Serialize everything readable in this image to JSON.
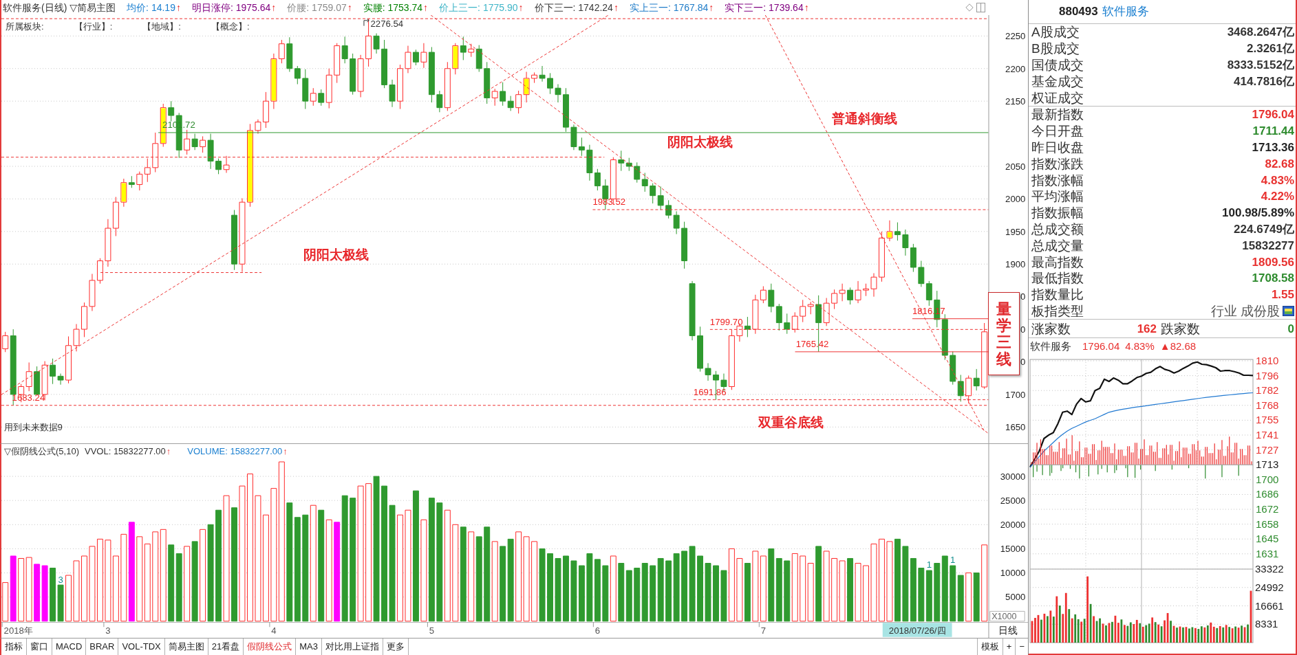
{
  "header": {
    "title": "软件服务(日线)",
    "template": "▽简易主图",
    "indicators": [
      {
        "text": "均价: 14.19",
        "trend": "↑",
        "color": "#1a7fd0"
      },
      {
        "text": "明日涨停: 1975.64",
        "trend": "↑",
        "color": "#800080"
      },
      {
        "text": "价腰: 1759.07",
        "trend": "↑",
        "color": "#8a8a8a"
      },
      {
        "text": "实腰: 1753.74",
        "trend": "↑",
        "color": "#008000"
      },
      {
        "text": "价上三一: 1775.90",
        "trend": "↑",
        "color": "#3fb5c8"
      },
      {
        "text": "价下三一: 1742.24",
        "trend": "↑",
        "color": "#3a3a3a"
      },
      {
        "text": "实上三一: 1767.84",
        "trend": "↑",
        "color": "#1f7cc8"
      },
      {
        "text": "实下三一: 1739.64",
        "trend": "↑",
        "color": "#800080"
      }
    ]
  },
  "sector": {
    "label": "所属板块:",
    "tags": [
      "【行业】:",
      "【地域】:",
      "【概念】:"
    ]
  },
  "price_chart": {
    "chart_data": {
      "type": "candlestick",
      "grid": true,
      "ylim": [
        1625,
        2282
      ],
      "yticks": [
        {
          "value": 2250,
          "label": "2250"
        },
        {
          "value": 2200,
          "label": "2200"
        },
        {
          "value": 2150,
          "label": "2150"
        },
        {
          "value": 2050,
          "label": "2050"
        },
        {
          "value": 2000,
          "label": "2000"
        },
        {
          "value": 1950,
          "label": "1950"
        },
        {
          "value": 1900,
          "label": "1900"
        },
        {
          "value": 1700,
          "label": "1700"
        },
        {
          "value": 1650,
          "label": "1650"
        }
      ],
      "ohlc": [
        [
          1770,
          1796,
          1765,
          1790
        ],
        [
          1790,
          1800,
          1683.24,
          1700
        ],
        [
          1700,
          1716,
          1688,
          1712
        ],
        [
          1712,
          1749,
          1705,
          1735
        ],
        [
          1735,
          1743,
          1700,
          1700
        ],
        [
          1700,
          1751,
          1691,
          1745
        ],
        [
          1745,
          1755,
          1716,
          1728
        ],
        [
          1728,
          1732,
          1715,
          1722
        ],
        [
          1722,
          1789,
          1717,
          1775
        ],
        [
          1775,
          1808,
          1766,
          1800
        ],
        [
          1800,
          1841,
          1788,
          1835
        ],
        [
          1835,
          1885,
          1828,
          1875
        ],
        [
          1875,
          1909,
          1870,
          1905
        ],
        [
          1905,
          1969,
          1896,
          1955
        ],
        [
          1955,
          2003,
          1943,
          1995
        ],
        [
          1995,
          2031,
          1988,
          2025
        ],
        [
          2025,
          2035,
          2017,
          2022
        ],
        [
          2022,
          2042,
          2013,
          2038
        ],
        [
          2038,
          2062,
          2026,
          2048
        ],
        [
          2048,
          2101.72,
          2041,
          2085
        ],
        [
          2085,
          2146,
          2080,
          2140
        ],
        [
          2140,
          2150,
          2119,
          2128
        ],
        [
          2128,
          2132,
          2063,
          2075
        ],
        [
          2075,
          2106,
          2068,
          2092
        ],
        [
          2092,
          2100,
          2075,
          2080
        ],
        [
          2080,
          2096,
          2071,
          2090
        ],
        [
          2090,
          2100,
          2046,
          2058
        ],
        [
          2058,
          2062,
          2038,
          2045
        ],
        [
          2045,
          2066,
          2040,
          2052
        ],
        [
          1975,
          1983,
          1891,
          1900
        ],
        [
          1900,
          2001,
          1888,
          1995
        ],
        [
          1995,
          2115,
          1988,
          2105
        ],
        [
          2105,
          2122,
          2100,
          2118
        ],
        [
          2118,
          2164,
          2109,
          2150
        ],
        [
          2150,
          2223,
          2138,
          2215
        ],
        [
          2215,
          2244,
          2208,
          2238
        ],
        [
          2238,
          2248,
          2195,
          2200
        ],
        [
          2200,
          2204,
          2176,
          2185
        ],
        [
          2185,
          2199,
          2138,
          2150
        ],
        [
          2150,
          2170,
          2143,
          2162
        ],
        [
          2162,
          2168,
          2143,
          2148
        ],
        [
          2148,
          2200,
          2139,
          2190
        ],
        [
          2190,
          2239,
          2178,
          2235
        ],
        [
          2235,
          2249,
          2208,
          2215
        ],
        [
          2215,
          2223,
          2160,
          2165
        ],
        [
          2165,
          2221,
          2156,
          2215
        ],
        [
          2215,
          2276.54,
          2203,
          2250
        ],
        [
          2250,
          2254,
          2223,
          2230
        ],
        [
          2230,
          2244,
          2170,
          2175
        ],
        [
          2175,
          2183,
          2141,
          2150
        ],
        [
          2150,
          2206,
          2138,
          2200
        ],
        [
          2200,
          2235,
          2193,
          2225
        ],
        [
          2225,
          2229,
          2205,
          2210
        ],
        [
          2210,
          2239,
          2201,
          2225
        ],
        [
          2225,
          2233,
          2148,
          2160
        ],
        [
          2160,
          2166,
          2133,
          2140
        ],
        [
          2140,
          2210,
          2135,
          2200
        ],
        [
          2200,
          2239,
          2191,
          2235
        ],
        [
          2235,
          2249,
          2213,
          2225
        ],
        [
          2225,
          2238,
          2218,
          2230
        ],
        [
          2230,
          2236,
          2195,
          2200
        ],
        [
          2200,
          2210,
          2146,
          2155
        ],
        [
          2155,
          2169,
          2143,
          2165
        ],
        [
          2165,
          2179,
          2143,
          2150
        ],
        [
          2150,
          2158,
          2135,
          2140
        ],
        [
          2140,
          2166,
          2131,
          2160
        ],
        [
          2160,
          2195,
          2148,
          2185
        ],
        [
          2185,
          2194,
          2178,
          2190
        ],
        [
          2190,
          2204,
          2180,
          2185
        ],
        [
          2185,
          2193,
          2161,
          2170
        ],
        [
          2170,
          2176,
          2148,
          2160
        ],
        [
          2160,
          2170,
          2103,
          2110
        ],
        [
          2110,
          2114,
          2075,
          2080
        ],
        [
          2080,
          2094,
          2066,
          2075
        ],
        [
          2075,
          2083,
          2028,
          2040
        ],
        [
          2040,
          2046,
          2013,
          2020
        ],
        [
          2020,
          2030,
          1983.52,
          2000
        ],
        [
          2000,
          2064,
          1991,
          2060
        ],
        [
          2060,
          2074,
          2043,
          2055
        ],
        [
          2055,
          2063,
          2043,
          2050
        ],
        [
          2050,
          2056,
          2025,
          2030
        ],
        [
          2030,
          2040,
          2011,
          2020
        ],
        [
          2020,
          2024,
          1993,
          2005
        ],
        [
          2005,
          2019,
          1983,
          1990
        ],
        [
          1990,
          1998,
          1970,
          1975
        ],
        [
          1975,
          1981,
          1946,
          1955
        ],
        [
          1955,
          1965,
          1893,
          1905
        ],
        [
          1870,
          1874,
          1783,
          1790
        ],
        [
          1790,
          1804,
          1735,
          1740
        ],
        [
          1740,
          1748,
          1721,
          1730
        ],
        [
          1730,
          1736,
          1691.86,
          1722
        ],
        [
          1722,
          1732,
          1705,
          1712
        ],
        [
          1712,
          1799.7,
          1707,
          1790
        ],
        [
          1790,
          1809,
          1781,
          1805
        ],
        [
          1805,
          1819,
          1788,
          1800
        ],
        [
          1800,
          1853,
          1793,
          1845
        ],
        [
          1845,
          1866,
          1840,
          1860
        ],
        [
          1860,
          1870,
          1826,
          1835
        ],
        [
          1835,
          1839,
          1798,
          1810
        ],
        [
          1810,
          1824,
          1793,
          1800
        ],
        [
          1800,
          1826,
          1795,
          1820
        ],
        [
          1820,
          1845,
          1811,
          1835
        ],
        [
          1835,
          1842,
          1823,
          1838
        ],
        [
          1838,
          1852,
          1765.42,
          1810
        ],
        [
          1810,
          1848,
          1805,
          1840
        ],
        [
          1840,
          1861,
          1831,
          1855
        ],
        [
          1855,
          1870,
          1843,
          1860
        ],
        [
          1860,
          1864,
          1838,
          1845
        ],
        [
          1845,
          1874,
          1840,
          1860
        ],
        [
          1860,
          1870,
          1851,
          1862
        ],
        [
          1862,
          1886,
          1850,
          1880
        ],
        [
          1880,
          1950,
          1873,
          1940
        ],
        [
          1940,
          1967,
          1935,
          1950
        ],
        [
          1950,
          1964,
          1936,
          1945
        ],
        [
          1945,
          1953,
          1913,
          1925
        ],
        [
          1925,
          1931,
          1888,
          1895
        ],
        [
          1895,
          1905,
          1865,
          1870
        ],
        [
          1870,
          1874,
          1836,
          1845
        ],
        [
          1845,
          1859,
          1803,
          1815
        ],
        [
          1815,
          1823,
          1753,
          1760
        ],
        [
          1760,
          1766,
          1715,
          1720
        ],
        [
          1720,
          1730,
          1689,
          1698
        ],
        [
          1698,
          1729,
          1686,
          1725
        ],
        [
          1725,
          1739,
          1706,
          1713
        ],
        [
          1711.44,
          1809.56,
          1708.58,
          1796.04
        ]
      ]
    },
    "axis_fragments": [
      "0",
      "0",
      "0"
    ],
    "price_marks": [
      {
        "text": "2276.54",
        "color": "#333333"
      },
      {
        "text": "2101.72",
        "color": "#2e8b2e"
      },
      {
        "text": "1983.52",
        "color": "#ee2222"
      },
      {
        "text": "1799.70",
        "color": "#ee2222"
      },
      {
        "text": "1765.42",
        "color": "#ee2222"
      },
      {
        "text": "1816.17",
        "color": "#ee2222"
      },
      {
        "text": "1691.86",
        "color": "#ee2222"
      },
      {
        "text": "1683.24",
        "color": "#ee2222"
      }
    ],
    "annotations": [
      "普通斜衡线",
      "阴阳太极线",
      "阴阳太极线",
      "双重谷底线"
    ],
    "side_label": "量学三线",
    "notice": "用到未来数据9"
  },
  "volume_chart": {
    "formula": "▽假阴线公式(5,10)",
    "readings": [
      {
        "text": "VVOL: 15832277.00",
        "trend": "↑",
        "color": "#333333"
      },
      {
        "text": "VOLUME: 15832277.00",
        "trend": "↑",
        "color": "#1a7fd0"
      }
    ],
    "unit": "X1000",
    "bar_marks": [
      "3",
      "1",
      "1"
    ],
    "chart_data": {
      "type": "bar",
      "grid": true,
      "ylim": [
        0,
        36700
      ],
      "yticks": [
        {
          "value": 30000,
          "label": "30000"
        },
        {
          "value": 25000,
          "label": "25000"
        },
        {
          "value": 20000,
          "label": "20000"
        },
        {
          "value": 15000,
          "label": "15000"
        },
        {
          "value": 10000,
          "label": "10000"
        },
        {
          "value": 5000,
          "label": "5000"
        }
      ],
      "values": [
        8000,
        13500,
        13000,
        13200,
        11800,
        11500,
        11000,
        7500,
        9500,
        12500,
        13500,
        15500,
        17000,
        16800,
        13500,
        18000,
        20500,
        17500,
        16000,
        18500,
        19000,
        15800,
        14000,
        15500,
        16500,
        19000,
        20000,
        23000,
        26000,
        23500,
        28000,
        30500,
        26000,
        22000,
        27500,
        33000,
        24500,
        21500,
        22000,
        24000,
        23000,
        21000,
        20500,
        26000,
        25500,
        28000,
        28500,
        30000,
        28000,
        24000,
        22000,
        23000,
        27000,
        21000,
        25500,
        24500,
        23000,
        20000,
        19500,
        18500,
        17500,
        19500,
        16500,
        15500,
        17000,
        18500,
        17500,
        16500,
        15000,
        14000,
        13000,
        13500,
        12500,
        11500,
        14000,
        12800,
        11500,
        13500,
        12000,
        10500,
        11000,
        12000,
        11500,
        13000,
        12500,
        14000,
        14500,
        15500,
        13500,
        12000,
        11500,
        10500,
        15000,
        13000,
        12000,
        14500,
        13500,
        15000,
        13000,
        12500,
        14000,
        13500,
        12000,
        15500,
        14500,
        13000,
        12500,
        13000,
        12000,
        11500,
        16000,
        17000,
        16500,
        17000,
        15500,
        13000,
        11000,
        10500,
        12000,
        13500,
        11500,
        9500,
        10000,
        10000,
        15800
      ]
    }
  },
  "x_axis": {
    "labels": [
      "2018年",
      "3",
      "4",
      "5",
      "6",
      "7"
    ],
    "cursor_date": "2018/07/26/四",
    "period": "日线"
  },
  "tabs": [
    {
      "label": "指标",
      "selected": false
    },
    {
      "label": "窗口",
      "selected": false
    },
    {
      "label": "MACD",
      "selected": false
    },
    {
      "label": "BRAR",
      "selected": false
    },
    {
      "label": "VOL-TDX",
      "selected": false
    },
    {
      "label": "简易主图",
      "selected": false
    },
    {
      "label": "21看盘",
      "selected": false
    },
    {
      "label": "假阴线公式",
      "selected": true
    },
    {
      "label": "MA3",
      "selected": false
    },
    {
      "label": "对比用上证指",
      "selected": false
    },
    {
      "label": "更多",
      "selected": false
    }
  ],
  "footer_buttons": [
    "模板",
    "+",
    "−"
  ],
  "quote_panel": {
    "code": "880493",
    "name": "软件服务",
    "trade_rows": [
      {
        "label": "A股成交",
        "value": "3468.2647亿"
      },
      {
        "label": "B股成交",
        "value": "2.3261亿"
      },
      {
        "label": "国债成交",
        "value": "8333.5152亿"
      },
      {
        "label": "基金成交",
        "value": "414.7816亿"
      },
      {
        "label": "权证成交"
      }
    ],
    "index_rows": [
      {
        "label": "最新指数",
        "value": "1796.04",
        "color": "#e8312f",
        "kind": "number"
      },
      {
        "label": "今日开盘",
        "value": "1711.44",
        "color": "#2e8b2e",
        "kind": "number"
      },
      {
        "label": "昨日收盘",
        "value": "1713.36",
        "color": "#222222",
        "kind": "number"
      },
      {
        "label": "指数涨跌",
        "value": "82.68",
        "color": "#e8312f",
        "kind": "number"
      },
      {
        "label": "指数涨幅",
        "value": "4.83%",
        "color": "#e8312f",
        "kind": "number"
      },
      {
        "label": "平均涨幅",
        "value": "4.22%",
        "color": "#e8312f",
        "kind": "number"
      },
      {
        "label": "指数振幅",
        "value": "100.98/5.89%",
        "color": "#222222",
        "kind": "number"
      },
      {
        "label": "总成交额",
        "value": "224.6749亿",
        "color": "#333333",
        "kind": "number"
      },
      {
        "label": "总成交量",
        "value": "15832277",
        "color": "#333333",
        "kind": "number"
      },
      {
        "label": "最高指数",
        "value": "1809.56",
        "color": "#e8312f",
        "kind": "number"
      },
      {
        "label": "最低指数",
        "value": "1708.58",
        "color": "#2e8b2e",
        "kind": "number"
      },
      {
        "label": "指数量比",
        "value": "1.55",
        "color": "#e8312f",
        "kind": "number"
      },
      {
        "label": "板指类型",
        "value": "行业 成份股",
        "color": "#555555",
        "kind": "type"
      }
    ],
    "breadth": {
      "up_label": "涨家数",
      "up_count": "162",
      "down_label": "跌家数",
      "down_count": "0"
    }
  },
  "intraday": {
    "name": "软件服务",
    "price": "1796.04",
    "change_pct": "4.83%",
    "change": "▲82.68",
    "chart_data": {
      "type": "line",
      "grid": true,
      "ylim": [
        1630.92,
        1809.56
      ],
      "yticks": [
        {
          "value": 1809.56,
          "label": "1810"
        },
        {
          "value": 1795.82,
          "label": "1796"
        },
        {
          "value": 1782.08,
          "label": "1782"
        },
        {
          "value": 1768.34,
          "label": "1768"
        },
        {
          "value": 1754.6,
          "label": "1755"
        },
        {
          "value": 1740.86,
          "label": "1741"
        },
        {
          "value": 1727.12,
          "label": "1727"
        },
        {
          "value": 1713.36,
          "label": "1713"
        },
        {
          "value": 1699.62,
          "label": "1700"
        },
        {
          "value": 1685.88,
          "label": "1686"
        },
        {
          "value": 1672.14,
          "label": "1672"
        },
        {
          "value": 1658.4,
          "label": "1658"
        },
        {
          "value": 1644.66,
          "label": "1645"
        },
        {
          "value": 1630.92,
          "label": "1631"
        }
      ],
      "series": [
        {
          "color": "#111111",
          "values": [
            1711.2,
            1718.6,
            1726.0,
            1737.7,
            1740.8,
            1743.0,
            1751.4,
            1762.0,
            1763.0,
            1759.9,
            1769.4,
            1774.7,
            1771.5,
            1772.6,
            1782.1,
            1784.2,
            1792.6,
            1790.5,
            1793.7,
            1791.6,
            1788.4,
            1788.4,
            1791.0,
            1794.1,
            1795.4,
            1797.9,
            1799.0,
            1802.2,
            1804.3,
            1801.7,
            1800.5,
            1798.3,
            1800.0,
            1802.6,
            1804.7,
            1807.4,
            1808.5,
            1806.4,
            1806.0,
            1804.7,
            1803.2,
            1800.0,
            1800.5,
            1800.5,
            1799.6,
            1798.3,
            1796.2,
            1796.2,
            1796.0
          ]
        },
        {
          "color": "#1f78d1",
          "values": [
            1711.2,
            1716,
            1721,
            1726,
            1730,
            1734,
            1738,
            1741.5,
            1744.5,
            1747,
            1749,
            1751,
            1753,
            1754.5,
            1756,
            1758,
            1760,
            1762,
            1763,
            1764,
            1764.8,
            1765.5,
            1766.2,
            1766.8,
            1767.4,
            1768,
            1768.6,
            1769.2,
            1769.8,
            1770.4,
            1771,
            1771.6,
            1772.2,
            1772.8,
            1773.4,
            1774,
            1774.6,
            1775.2,
            1775.7,
            1776.2,
            1776.7,
            1777.2,
            1777.7,
            1778.1,
            1778.5,
            1778.9,
            1779.3,
            1779.7,
            1780
          ]
        }
      ]
    }
  },
  "intraday_volume": {
    "chart_data": {
      "type": "bar",
      "grid": true,
      "ylim": [
        0,
        33322
      ],
      "yticks": [
        {
          "value": 33322,
          "label": "33322"
        },
        {
          "value": 24992,
          "label": "24992"
        },
        {
          "value": 16661,
          "label": "16661"
        },
        {
          "value": 8331,
          "label": "8331"
        }
      ],
      "series": [
        {
          "color": "#ee3030",
          "values": [
            9800,
            11200,
            12500,
            null,
            13100,
            null,
            14500,
            null,
            21000,
            null,
            13000,
            22500,
            null,
            11000,
            null,
            null,
            9500,
            null,
            30000,
            null,
            12000,
            null,
            null,
            8600,
            null,
            8900,
            null,
            12200,
            9000,
            null,
            8000,
            null,
            null,
            8400,
            10300,
            null,
            7200,
            null,
            null,
            11400,
            null,
            8200,
            null,
            10100,
            13400,
            null,
            7600,
            null,
            7300,
            null,
            7100,
            null,
            null,
            6600,
            null,
            null,
            6900,
            null,
            9100,
            7200,
            null,
            7500,
            null,
            8000,
            null,
            6500,
            null,
            6800,
            null,
            7000,
            null,
            23500
          ]
        },
        {
          "color": "#2e8b2e",
          "values": [
            null,
            null,
            null,
            10400,
            null,
            12000,
            null,
            11800,
            null,
            16800,
            null,
            null,
            15200,
            null,
            12800,
            10600,
            null,
            10800,
            null,
            17500,
            null,
            9800,
            11000,
            null,
            7800,
            null,
            9400,
            null,
            null,
            10500,
            null,
            7600,
            9200,
            null,
            null,
            8800,
            null,
            7900,
            8600,
            null,
            9300,
            null,
            7400,
            null,
            null,
            9900,
            null,
            6800,
            null,
            6900,
            null,
            6400,
            7000,
            null,
            6200,
            7400,
            null,
            7800,
            null,
            null,
            6600,
            null,
            6900,
            null,
            7100,
            null,
            7300,
            null,
            7700,
            null,
            8200,
            null
          ]
        }
      ]
    }
  }
}
